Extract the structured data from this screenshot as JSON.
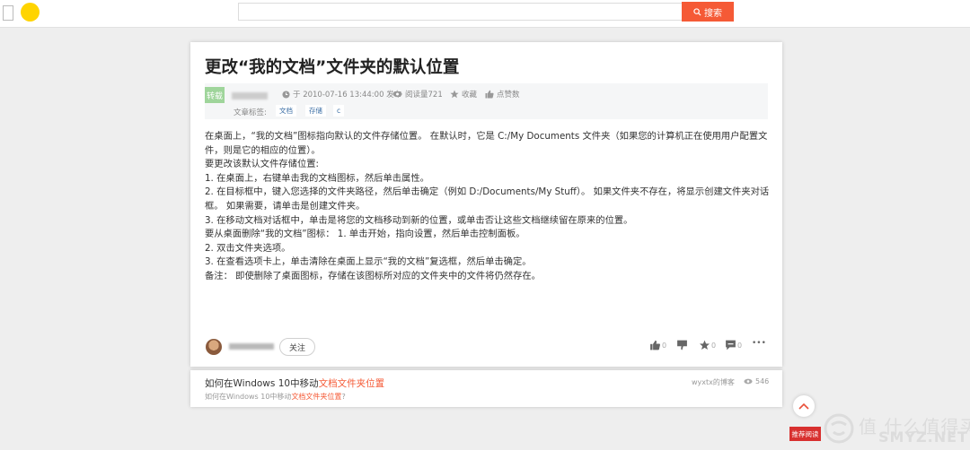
{
  "topbar": {
    "search_placeholder": "",
    "search_button_label": "搜索",
    "accent_color": "#f55a36",
    "logo_color": "#ffd400"
  },
  "article": {
    "title": "更改“我的文档”文件夹的默认位置",
    "badge": "转载",
    "publish_time": "于 2010-07-16 13:44:00 发布",
    "reads": "阅读量721",
    "favorite": "收藏",
    "likes": "点赞数",
    "tags_label": "文章标签:",
    "tags": [
      "文档",
      "存储",
      "c"
    ],
    "paragraphs": [
      "在桌面上，“我的文档”图标指向默认的文件存储位置。 在默认时，它是 C:/My Documents 文件夹（如果您的计算机正在使用用户配置文件，则是它的相应的位置）。",
      "要更改该默认文件存储位置:",
      "1. 在桌面上，右键单击我的文档图标，然后单击属性。",
      "2. 在目标框中，键入您选择的文件夹路径，然后单击确定（例如 D:/Documents/My Stuff）。 如果文件夹不存在，将显示创建文件夹对话框。 如果需要，请单击是创建文件夹。",
      "3. 在移动文档对话框中，单击是将您的文档移动到新的位置，或单击否让这些文档继续留在原来的位置。",
      "要从桌面删除“我的文档”图标： 1. 单击开始，指向设置，然后单击控制面板。",
      "2. 双击文件夹选项。",
      "3. 在查看选项卡上，单击清除在桌面上显示“我的文档”复选框，然后单击确定。",
      "备注： 即使删除了桌面图标，存储在该图标所对应的文件夹中的文件将仍然存在。"
    ]
  },
  "footer": {
    "follow_label": "关注",
    "like_count": "0",
    "dislike_count": "",
    "favorite_count": "0",
    "comment_count": "0",
    "more": "•••"
  },
  "related": {
    "title_prefix": "如何在Windows 10中移动",
    "title_highlight": "文档文件夹位置",
    "sub_prefix": "如何在Windows 10中移动",
    "sub_highlight": "文档文件夹位置",
    "sub_suffix": "?",
    "source": "wyxtx的博客",
    "views": "546"
  },
  "floating": {
    "recommend_label": "推荐阅读",
    "watermark_text": "值 什么值得买",
    "watermark_sub": "SMYZ.NET"
  }
}
